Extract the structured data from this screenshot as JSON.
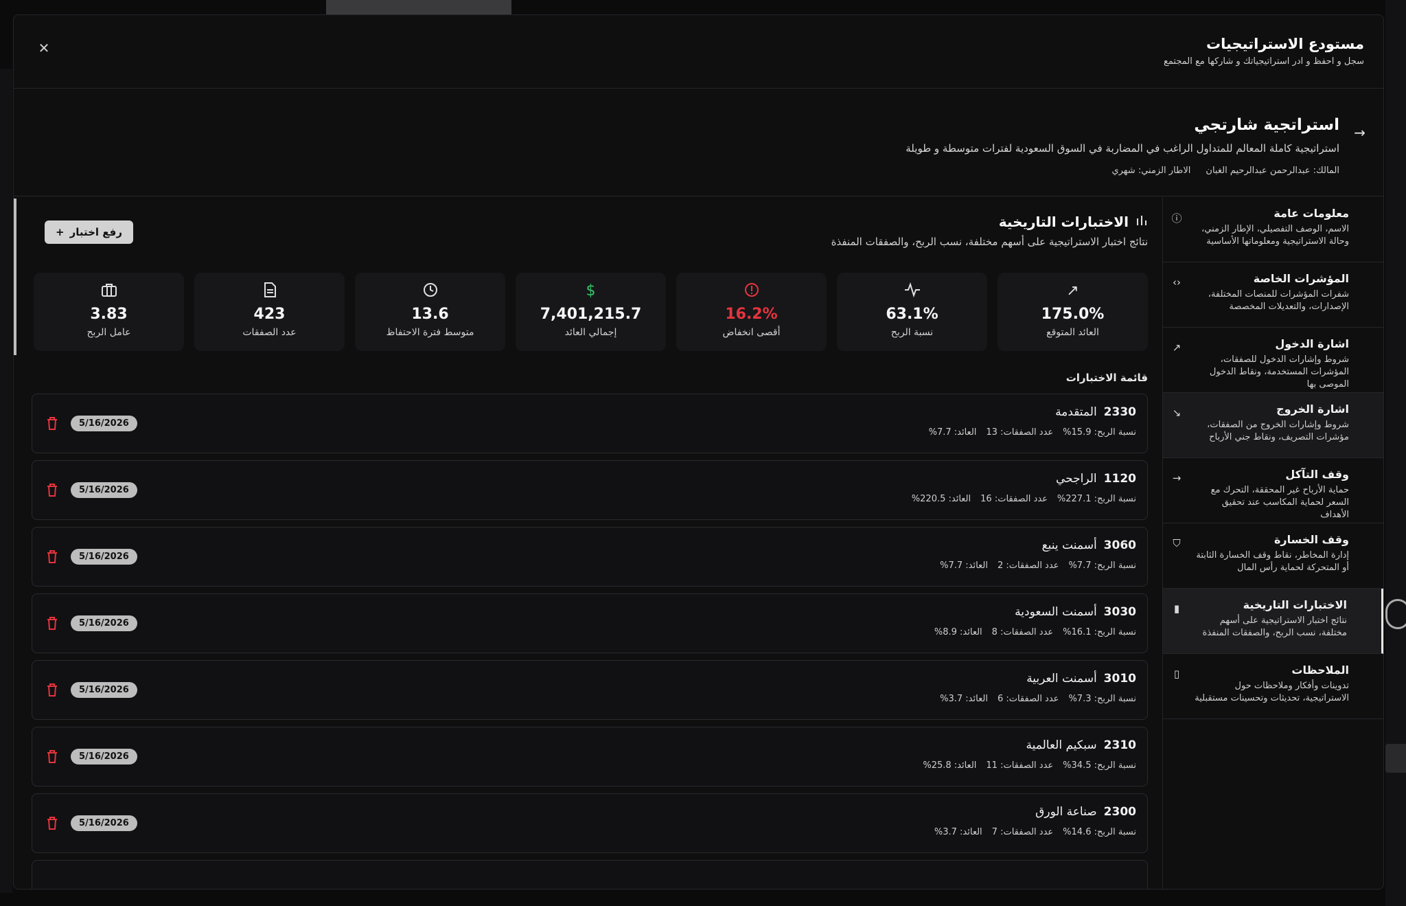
{
  "modal": {
    "title": "مستودع الاستراتيجيات",
    "subtitle": "سجل و احفظ و ادر استراتيجياتك و شاركها مع المجتمع"
  },
  "strategy": {
    "name": "استراتجية شارتجي",
    "description": "استراتيجية كاملة المعالم للمتداول الراغب في المضاربة في السوق السعودية لفترات متوسطة و طويلة",
    "owner": "المالك: عبدالرحمن عبدالرحيم الغبان",
    "timeframe": "الاطار الزمني: شهري"
  },
  "nav": [
    {
      "title": "معلومات عامة",
      "desc": "الاسم، الوصف التفصيلي، الإطار الزمني، وحالة الاستراتيجية ومعلوماتها الأساسية",
      "icon": "info-icon"
    },
    {
      "title": "المؤشرات الخاصة",
      "desc": "شفرات المؤشرات للمنصات المختلفة، الإصدارات، والتعديلات المخصصة",
      "icon": "code-icon"
    },
    {
      "title": "اشارة الدخول",
      "desc": "شروط وإشارات الدخول للصفقات، المؤشرات المستخدمة، ونقاط الدخول الموصى بها",
      "icon": "trending-up-icon"
    },
    {
      "title": "اشارة الخروج",
      "desc": "شروط وإشارات الخروج من الصفقات، مؤشرات التصريف، ونقاط جني الأرباح",
      "icon": "trending-down-icon"
    },
    {
      "title": "وقف التآكل",
      "desc": "حماية الأرباح غير المحققة، التحرك مع السعر لحماية المكاسب عند تحقيق الأهداف",
      "icon": "arrow-right-icon"
    },
    {
      "title": "وقف الخسارة",
      "desc": "إدارة المخاطر، نقاط وقف الخسارة الثابتة أو المتحركة لحماية رأس المال",
      "icon": "shield-icon"
    },
    {
      "title": "الاختبارات التاريخية",
      "desc": "نتائج اختبار الاستراتيجية على أسهم مختلفة، نسب الربح، والصفقات المنفذة",
      "icon": "bar-chart-icon"
    },
    {
      "title": "الملاحظات",
      "desc": "تدوينات وأفكار وملاحظات حول الاستراتيجية، تحديثات وتحسينات مستقبلية",
      "icon": "note-icon"
    }
  ],
  "section": {
    "title": "الاختبارات التاريخية",
    "desc": "نتائج اختبار الاستراتيجية على أسهم مختلفة، نسب الربح، والصفقات المنفذة",
    "upload_label": "رفع اختبار",
    "list_title": "قائمة الاختبارات"
  },
  "stats": [
    {
      "value": "175.0%",
      "label": "العائد المتوقع",
      "icon": "trending-up-icon"
    },
    {
      "value": "63.1%",
      "label": "نسبة الربح",
      "icon": "activity-icon"
    },
    {
      "value": "16.2%",
      "label": "أقصى انخفاض",
      "icon": "alert-circle-icon",
      "color": "#e5343d"
    },
    {
      "value": "7,401,215.7",
      "label": "إجمالي العائد",
      "icon": "dollar-icon",
      "color": "#35c46a"
    },
    {
      "value": "13.6",
      "label": "متوسط فترة الاحتفاظ",
      "icon": "clock-icon"
    },
    {
      "value": "423",
      "label": "عدد الصفقات",
      "icon": "document-icon"
    },
    {
      "value": "3.83",
      "label": "عامل الربح",
      "icon": "briefcase-icon"
    }
  ],
  "tests": [
    {
      "code": "2330",
      "name": "المتقدمة",
      "win": "نسبة الربح: 15.9%",
      "trades": "عدد الصفقات: 13",
      "ret": "العائد: 7.7%",
      "date": "5/16/2026"
    },
    {
      "code": "1120",
      "name": "الراجحي",
      "win": "نسبة الربح: 227.1%",
      "trades": "عدد الصفقات: 16",
      "ret": "العائد: 220.5%",
      "date": "5/16/2026"
    },
    {
      "code": "3060",
      "name": "أسمنت ينبع",
      "win": "نسبة الربح: 7.7%",
      "trades": "عدد الصفقات: 2",
      "ret": "العائد: 7.7%",
      "date": "5/16/2026"
    },
    {
      "code": "3030",
      "name": "أسمنت السعودية",
      "win": "نسبة الربح: 16.1%",
      "trades": "عدد الصفقات: 8",
      "ret": "العائد: 8.9%",
      "date": "5/16/2026"
    },
    {
      "code": "3010",
      "name": "أسمنت العربية",
      "win": "نسبة الربح: 7.3%",
      "trades": "عدد الصفقات: 6",
      "ret": "العائد: 3.7%",
      "date": "5/16/2026"
    },
    {
      "code": "2310",
      "name": "سبكيم العالمية",
      "win": "نسبة الربح: 34.5%",
      "trades": "عدد الصفقات: 11",
      "ret": "العائد: 25.8%",
      "date": "5/16/2026"
    },
    {
      "code": "2300",
      "name": "صناعة الورق",
      "win": "نسبة الربح: 14.6%",
      "trades": "عدد الصفقات: 7",
      "ret": "العائد: 3.7%",
      "date": "5/16/2026"
    }
  ]
}
